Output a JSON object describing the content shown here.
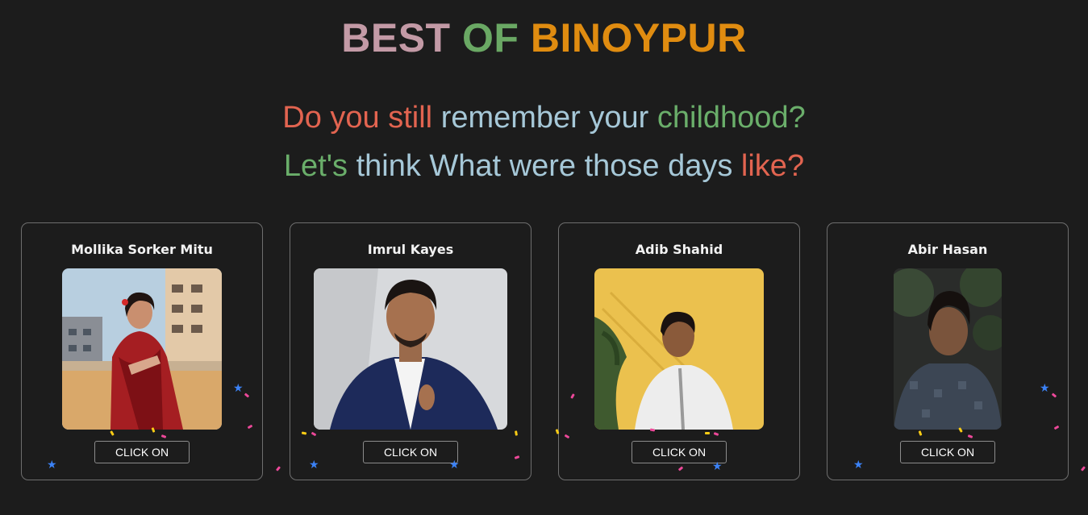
{
  "header": {
    "title_parts": [
      {
        "text": "BEST",
        "color": "#c39aa6"
      },
      {
        "text": "OF",
        "color": "#6aa864"
      },
      {
        "text": "BINOYPUR",
        "color": "#e08c10"
      }
    ]
  },
  "tagline": {
    "line1": [
      {
        "text": "Do you still",
        "color": "#e26450"
      },
      {
        "text": "remember your",
        "color": "#a6c8d8"
      },
      {
        "text": "childhood?",
        "color": "#6aae6a"
      }
    ],
    "line2": [
      {
        "text": "Let's",
        "color": "#6aae6a"
      },
      {
        "text": "think What were those days",
        "color": "#a6c8d8"
      },
      {
        "text": "like?",
        "color": "#e26450"
      }
    ]
  },
  "cards": [
    {
      "name": "Mollika Sorker Mitu",
      "button_label": "CLICK ON"
    },
    {
      "name": "Imrul Kayes",
      "button_label": "CLICK ON"
    },
    {
      "name": "Adib Shahid",
      "button_label": "CLICK ON"
    },
    {
      "name": "Abir Hasan",
      "button_label": "CLICK ON"
    }
  ],
  "decorations": {
    "confetti_colors": [
      "#3b82f6",
      "#ec4899",
      "#facc15"
    ]
  }
}
